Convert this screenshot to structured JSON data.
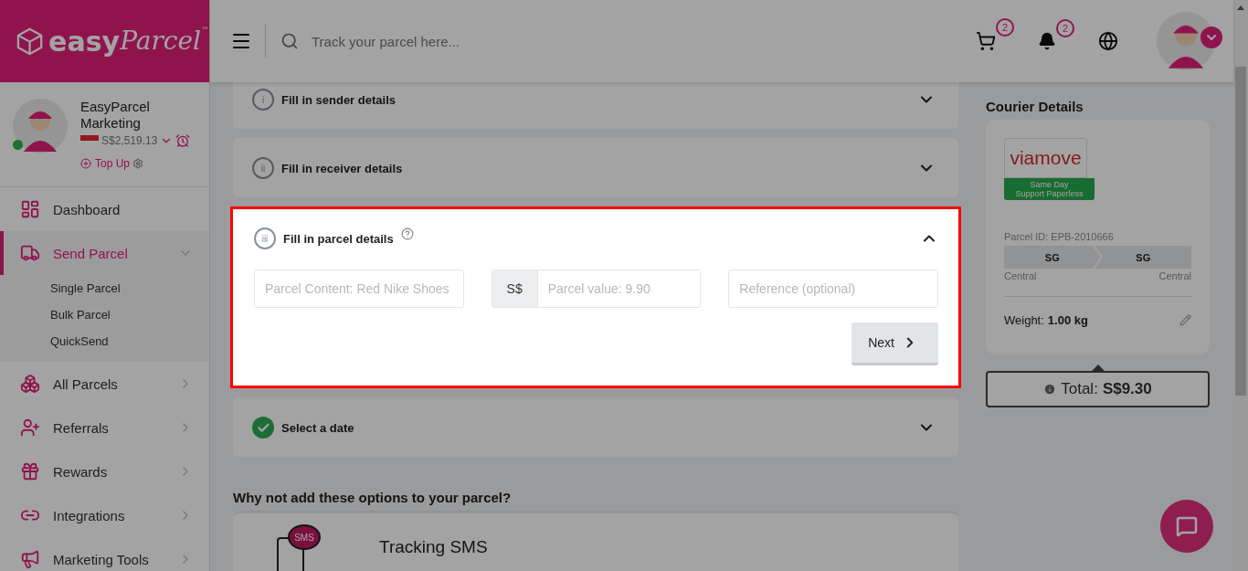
{
  "brand": {
    "name": "easy",
    "script": "Parcel",
    "mark": "™"
  },
  "profile": {
    "name": "EasyParcel Marketing",
    "online": true,
    "balance": "S$2,519.13",
    "top_up": "Top Up"
  },
  "sidebar": {
    "items": [
      {
        "label": "Dashboard",
        "selected": false
      },
      {
        "label": "Send Parcel",
        "selected": true,
        "expanded": true,
        "children": [
          {
            "label": "Single Parcel"
          },
          {
            "label": "Bulk Parcel"
          },
          {
            "label": "QuickSend"
          }
        ]
      },
      {
        "label": "All Parcels",
        "selected": false,
        "expanded": false
      },
      {
        "label": "Referrals",
        "selected": false,
        "expanded": false
      },
      {
        "label": "Rewards",
        "selected": false,
        "expanded": false
      },
      {
        "label": "Integrations",
        "selected": false,
        "expanded": false
      },
      {
        "label": "Marketing Tools",
        "selected": false,
        "expanded": false
      }
    ]
  },
  "topbar": {
    "search": {
      "placeholder": "Track your parcel here..."
    },
    "cart_count": "2",
    "notification_count": "2"
  },
  "steps": [
    {
      "number": "i",
      "title": "Fill in sender details",
      "completed": false,
      "expanded": false,
      "highlighted": false
    },
    {
      "number": "ii",
      "title": "Fill in receiver details",
      "completed": false,
      "expanded": false,
      "highlighted": false
    },
    {
      "number": "iii",
      "title": "Fill in parcel details",
      "completed": false,
      "expanded": true,
      "highlighted": true,
      "help": true,
      "fields": [
        {
          "placeholder": "Parcel Content: Red Nike Shoes"
        },
        {
          "prefix": "S$",
          "placeholder": "Parcel value: 9.90"
        },
        {
          "placeholder": "Reference (optional)"
        }
      ],
      "button": "Next"
    },
    {
      "title": "Select a date",
      "completed": true,
      "expanded": false,
      "highlighted": false
    }
  ],
  "options": {
    "heading": "Why not add these options to your parcel?",
    "items": [
      {
        "badge": "SMS",
        "title": "Tracking SMS"
      }
    ]
  },
  "courier": {
    "heading": "Courier Details",
    "logo": "viamove",
    "tags": [
      "Same Day",
      "Support Paperless"
    ],
    "parcel_id": "Parcel ID: EPB-2010666",
    "from": {
      "code": "SG",
      "region": "Central"
    },
    "to": {
      "code": "SG",
      "region": "Central"
    },
    "weight_label": "Weight:",
    "weight": "1.00 kg",
    "total_label": "Total:",
    "total": "S$9.30"
  }
}
